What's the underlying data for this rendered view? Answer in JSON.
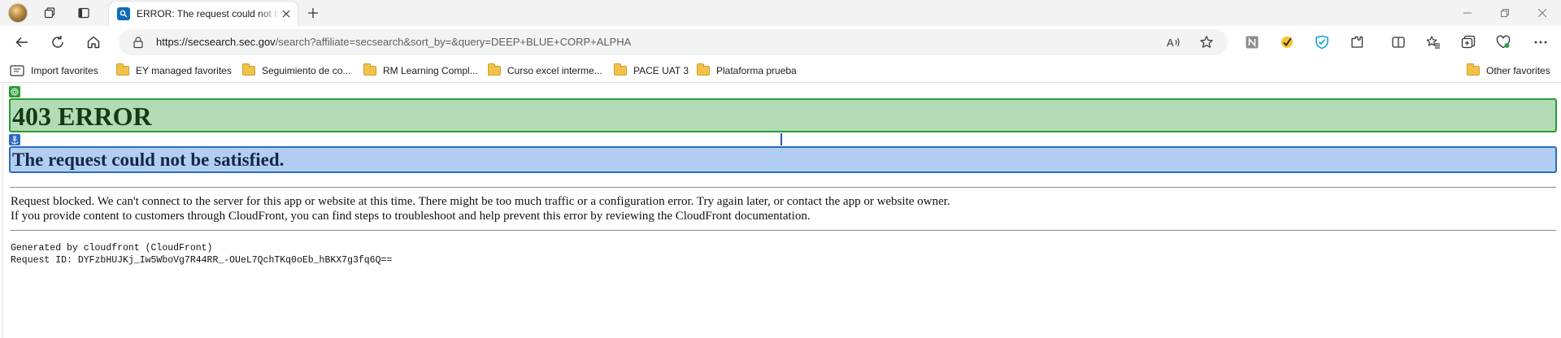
{
  "browser": {
    "tab": {
      "title": "ERROR: The request could not be satisfied"
    },
    "address_bar": {
      "url_host": "https://secsearch.sec.gov",
      "url_rest": "/search?affiliate=secsearch&sort_by=&query=DEEP+BLUE+CORP+ALPHA"
    },
    "favorites": [
      "Import favorites",
      "EY managed favorites",
      "Seguimiento de co...",
      "RM Learning Compl...",
      "Curso excel interme...",
      "PACE UAT 3",
      "Plataforma prueba"
    ],
    "other_favorites": "Other favorites"
  },
  "page": {
    "heading": "403 ERROR",
    "subheading": "The request could not be satisfied.",
    "paragraph_1": "Request blocked. We can't connect to the server for this app or website at this time. There might be too much traffic or a configuration error. Try again later, or contact the app or website owner.",
    "paragraph_2": "If you provide content to customers through CloudFront, you can find steps to troubleshoot and help prevent this error by reviewing the CloudFront documentation.",
    "generated_by": "Generated by cloudfront (CloudFront)",
    "request_id": "Request ID: DYFzbHUJKj_Iw5WboVg7R44RR_-OUeL7QchTKq0oEb_hBKX7g3fq6Q=="
  },
  "colors": {
    "h1_background": "#b3dbb5",
    "h1_border": "#2b9a36",
    "h2_background": "#b2cff3",
    "h2_border": "#2c6bc2",
    "accent": "#0f6cbd"
  },
  "icons": {
    "profile": "profile-avatar",
    "workspaces": "workspaces-icon",
    "tab_actions": "tab-actions-icon",
    "back": "back-arrow-icon",
    "refresh": "refresh-icon",
    "home": "home-icon",
    "lock": "lock-icon",
    "read_aloud": "read-aloud-icon",
    "favorite": "star-icon",
    "split_screen": "split-screen-icon",
    "favorites_menu": "favorites-icon",
    "collections": "collections-icon",
    "performance": "heartbeat-icon",
    "more": "more-icon"
  }
}
